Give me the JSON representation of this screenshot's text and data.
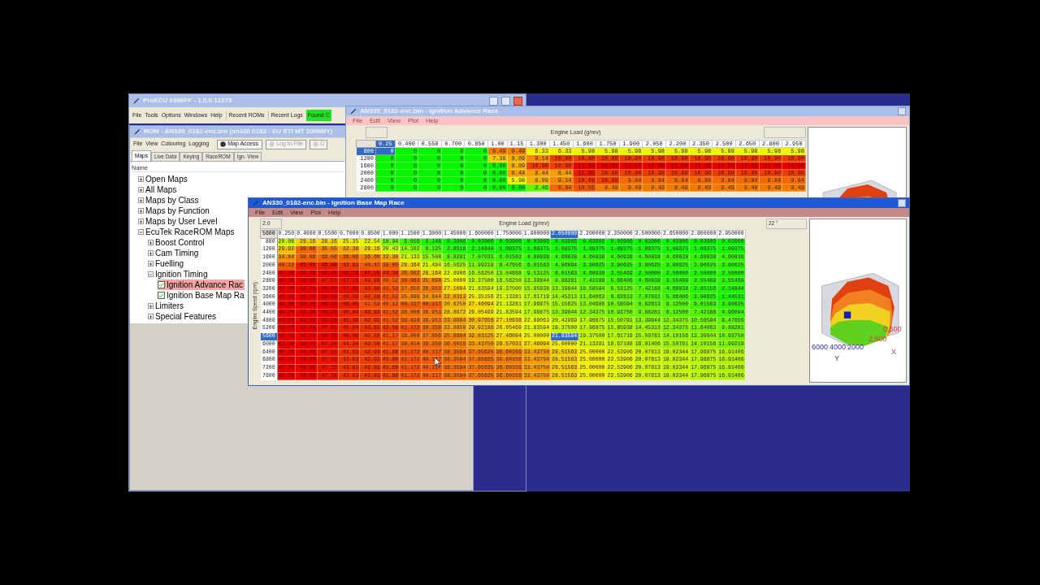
{
  "main_window": {
    "title": "ProECU 6986FF - 1.0.0.12275",
    "active": false,
    "menu": [
      "File",
      "Tools",
      "Options",
      "Windows",
      "Help"
    ],
    "toolbar": [
      {
        "label": "Recent ROMs",
        "kind": "button"
      },
      {
        "label": "Recent Logs",
        "kind": "button"
      },
      {
        "label": "Found C",
        "kind": "status"
      }
    ]
  },
  "rom_window": {
    "title": "ROM - AN330_0182-enc.bin (an330 0182 - EU STI MT 2008MY)",
    "active": false,
    "menu": [
      "File",
      "View",
      "Colouring",
      "Logging"
    ],
    "buttons": [
      {
        "label": "Map Access",
        "disabled": false
      },
      {
        "label": "Log to File",
        "disabled": true
      },
      {
        "label": "O",
        "disabled": true
      }
    ],
    "tabs": [
      {
        "label": "Maps",
        "selected": true
      },
      {
        "label": "Live Data",
        "selected": false
      },
      {
        "label": "Keying",
        "selected": false
      },
      {
        "label": "RaceROM",
        "selected": false
      },
      {
        "label": "Ign. View",
        "selected": false
      }
    ],
    "tree_header": "Name",
    "tree": [
      {
        "label": "Open Maps",
        "kind": "folder",
        "expanded": false,
        "selected": false
      },
      {
        "label": "All Maps",
        "kind": "folder",
        "expanded": false,
        "selected": false
      },
      {
        "label": "Maps by Class",
        "kind": "folder",
        "expanded": false,
        "selected": false
      },
      {
        "label": "Maps by Function",
        "kind": "folder",
        "expanded": false,
        "selected": false
      },
      {
        "label": "Maps by User Level",
        "kind": "folder",
        "expanded": false,
        "selected": false
      },
      {
        "label": "EcuTek RaceROM Maps",
        "kind": "folder",
        "expanded": true,
        "selected": false,
        "children": [
          {
            "label": "Boost Control",
            "kind": "folder",
            "expanded": false,
            "selected": false
          },
          {
            "label": "Cam Timing",
            "kind": "folder",
            "expanded": false,
            "selected": false
          },
          {
            "label": "Fuelling",
            "kind": "folder",
            "expanded": false,
            "selected": false
          },
          {
            "label": "Ignition Timing",
            "kind": "folder",
            "expanded": true,
            "selected": false,
            "children": [
              {
                "label": "Ignition Advance Rac",
                "kind": "map",
                "checked": true,
                "selected": true
              },
              {
                "label": "Ignition Base Map Ra",
                "kind": "map",
                "checked": true,
                "selected": false
              }
            ]
          },
          {
            "label": "Limiters",
            "kind": "folder",
            "expanded": false,
            "selected": false
          },
          {
            "label": "Special Features",
            "kind": "folder",
            "expanded": false,
            "selected": false
          }
        ]
      }
    ]
  },
  "advance_window": {
    "title": "AN330_0182-enc.bin - Ignition Advance Race",
    "active": false,
    "menu": [
      "File",
      "Edit",
      "View",
      "Plot",
      "Help"
    ],
    "axis_label": "Engine Load (g/rev)",
    "columns": [
      {
        "label": "0.25",
        "selected": true
      },
      {
        "label": "0.400",
        "selected": false
      },
      {
        "label": "0.550",
        "selected": false
      },
      {
        "label": "0.700",
        "selected": false
      },
      {
        "label": "0.850",
        "selected": false
      },
      {
        "label": "1.00",
        "selected": false
      },
      {
        "label": "1.15",
        "selected": false
      },
      {
        "label": "1.300",
        "selected": false
      },
      {
        "label": "1.450",
        "selected": false
      },
      {
        "label": "1.600",
        "selected": false
      },
      {
        "label": "1.750",
        "selected": false
      },
      {
        "label": "1.900",
        "selected": false
      },
      {
        "label": "2.050",
        "selected": false
      },
      {
        "label": "2.200",
        "selected": false
      },
      {
        "label": "2.350",
        "selected": false
      },
      {
        "label": "2.500",
        "selected": false
      },
      {
        "label": "2.650",
        "selected": false
      },
      {
        "label": "2.800",
        "selected": false
      },
      {
        "label": "2.950",
        "selected": false
      }
    ],
    "rows": [
      {
        "rpm": "800",
        "selected": true,
        "cells": [
          "0",
          "0",
          "0",
          "0",
          "0",
          "9.49",
          "9.49",
          "6.33",
          "6.33",
          "5.98",
          "5.98",
          "5.98",
          "5.98",
          "5.98",
          "5.98",
          "5.98",
          "5.98",
          "5.98",
          "5.98"
        ]
      },
      {
        "rpm": "1200",
        "selected": false,
        "cells": [
          "0",
          "0",
          "0",
          "0",
          "0",
          "7.38",
          "8.09",
          "9.14",
          "10.90",
          "10.90",
          "10.90",
          "10.90",
          "10.90",
          "10.90",
          "10.90",
          "10.90",
          "10.90",
          "10.90",
          "10.90"
        ]
      },
      {
        "rpm": "1600",
        "selected": false,
        "cells": [
          "0",
          "0",
          "0",
          "0",
          "0",
          "0.00",
          "8.09",
          "10.90",
          "10.90",
          "12.66",
          "12.66",
          "12.66",
          "12.66",
          "12.66",
          "12.66",
          "12.66",
          "12.66",
          "12.66",
          "12.66"
        ]
      },
      {
        "rpm": "2000",
        "selected": false,
        "cells": [
          "0",
          "0",
          "0",
          "0",
          "0",
          "0.00",
          "8.44",
          "8.44",
          "8.44",
          "11.95",
          "10.90",
          "10.90",
          "10.90",
          "10.90",
          "10.90",
          "10.90",
          "10.90",
          "10.90",
          "10.90"
        ]
      },
      {
        "rpm": "2400",
        "selected": false,
        "cells": [
          "0",
          "0",
          "0",
          "0",
          "0",
          "0.00",
          "5.98",
          "8.09",
          "9.14",
          "10.90",
          "10.90",
          "9.84",
          "9.84",
          "9.84",
          "9.84",
          "9.84",
          "9.84",
          "9.84",
          "9.84"
        ]
      },
      {
        "rpm": "2800",
        "selected": false,
        "cells": [
          "0",
          "0",
          "0",
          "0",
          "0",
          "0.00",
          "0.00",
          "2.46",
          "9.84",
          "10.55",
          "9.49",
          "9.49",
          "9.49",
          "9.49",
          "9.49",
          "9.49",
          "9.49",
          "9.49",
          "9.49"
        ]
      }
    ]
  },
  "base_window": {
    "title": "AN330_0182-enc.bin - Ignition Base Map Race",
    "active": true,
    "menu": [
      "File",
      "Edit",
      "View",
      "Plot",
      "Help"
    ],
    "field": "2.0",
    "axis_label": "Engine Load (g/rev)",
    "angle": "22 °",
    "corner": "5600",
    "y_axis_label": "Engine Speed (rpm)",
    "columns": [
      {
        "label": "0.250",
        "selected": false
      },
      {
        "label": "0.4000",
        "selected": false
      },
      {
        "label": "0.5500",
        "selected": false
      },
      {
        "label": "0.7000",
        "selected": false
      },
      {
        "label": "0.8500",
        "selected": false
      },
      {
        "label": "1.000",
        "selected": false
      },
      {
        "label": "1.1500",
        "selected": false
      },
      {
        "label": "1.3000",
        "selected": false
      },
      {
        "label": "1.45000",
        "selected": false
      },
      {
        "label": "1.600000",
        "selected": false
      },
      {
        "label": "1.750000",
        "selected": false
      },
      {
        "label": "1.900000",
        "selected": false
      },
      {
        "label": "2.050000",
        "selected": true
      },
      {
        "label": "2.200000",
        "selected": false
      },
      {
        "label": "2.350000",
        "selected": false
      },
      {
        "label": "2.500000",
        "selected": false
      },
      {
        "label": "2.650000",
        "selected": false
      },
      {
        "label": "2.800000",
        "selected": false
      },
      {
        "label": "2.950000",
        "selected": false
      }
    ],
    "rows": [
      {
        "rpm": "800",
        "selected": false,
        "cells": [
          "20.08",
          "28.16",
          "28.16",
          "25.35",
          "22.54",
          "10.94",
          "6.016",
          "2.148",
          "0.3906",
          "0.03906",
          "0.03906",
          "0.03906",
          "0.03906",
          "0.03906",
          "0.03906",
          "0.03906",
          "0.03906",
          "0.03906",
          "0.03906"
        ]
      },
      {
        "rpm": "1200",
        "selected": false,
        "cells": [
          "29.92",
          "39.06",
          "35.55",
          "32.38",
          "28.16",
          "20.43",
          "14.102",
          "8.125",
          "2.8516",
          "2.14844",
          "1.09375",
          "1.09375",
          "1.09375",
          "1.09375",
          "1.09375",
          "1.09375",
          "1.09375",
          "1.09375",
          "1.09375"
        ]
      },
      {
        "rpm": "1600",
        "selected": false,
        "cells": [
          "34.84",
          "39.06",
          "39.06",
          "39.06",
          "36.60",
          "32.38",
          "21.133",
          "15.508",
          "8.8281",
          "7.07031",
          "6.01563",
          "4.60938",
          "4.60938",
          "4.60938",
          "4.60938",
          "4.60938",
          "4.60938",
          "4.60938",
          "4.60938"
        ]
      },
      {
        "rpm": "2000",
        "selected": false,
        "cells": [
          "40.12",
          "46.09",
          "46.09",
          "42.93",
          "40.47",
          "39.06",
          "28.164",
          "21.484",
          "16.5625",
          "11.99219",
          "8.47656",
          "6.01563",
          "4.96094",
          "3.90625",
          "3.90625",
          "3.90625",
          "3.90625",
          "3.90625",
          "3.90625"
        ]
      },
      {
        "rpm": "2400",
        "selected": false,
        "cells": [
          "49.26",
          "49.26",
          "49.26",
          "49.26",
          "47.15",
          "44.34",
          "36.602",
          "28.164",
          "22.8906",
          "16.56250",
          "13.04688",
          "9.53125",
          "6.01563",
          "4.60938",
          "3.55469",
          "2.50000",
          "2.50000",
          "2.50000",
          "2.50000"
        ]
      },
      {
        "rpm": "2800",
        "selected": false,
        "cells": [
          "49.26",
          "49.26",
          "47.01",
          "47.15",
          "43.98",
          "40.12",
          "39.063",
          "35.898",
          "25.0000",
          "19.37500",
          "16.56250",
          "13.39844",
          "9.88281",
          "7.42188",
          "5.66406",
          "4.60938",
          "3.55469",
          "3.55469",
          "3.55469"
        ]
      },
      {
        "rpm": "3200",
        "selected": false,
        "cells": [
          "49.26",
          "49.26",
          "49.26",
          "47.85",
          "43.98",
          "41.52",
          "37.656",
          "36.953",
          "27.1094",
          "21.83594",
          "19.37500",
          "15.85938",
          "13.39844",
          "10.58594",
          "9.53125",
          "7.42188",
          "4.60938",
          "2.85156",
          "2.14844"
        ]
      },
      {
        "rpm": "3600",
        "selected": false,
        "cells": [
          "49.26",
          "49.26",
          "49.26",
          "45.39",
          "42.58",
          "41.52",
          "35.898",
          "34.844",
          "32.0313",
          "25.35156",
          "21.13281",
          "17.61719",
          "14.45313",
          "11.64063",
          "8.82813",
          "7.07031",
          "5.66406",
          "3.90625",
          "1.44531"
        ]
      },
      {
        "rpm": "4000",
        "selected": false,
        "cells": [
          "49.26",
          "49.26",
          "49.26",
          "46.45",
          "41.52",
          "40.12",
          "40.117",
          "40.117",
          "30.6250",
          "27.46094",
          "21.13281",
          "17.96875",
          "15.15625",
          "13.04688",
          "10.58594",
          "8.82813",
          "8.12500",
          "6.01563",
          "3.90625"
        ]
      },
      {
        "rpm": "4400",
        "selected": false,
        "cells": [
          "49.26",
          "49.26",
          "49.26",
          "45.04",
          "43.63",
          "41.52",
          "38.008",
          "36.953",
          "28.8672",
          "26.05469",
          "21.83594",
          "17.96875",
          "13.39844",
          "12.34375",
          "10.93750",
          "9.88281",
          "8.12500",
          "7.42188",
          "4.96094"
        ]
      },
      {
        "rpm": "4800",
        "selected": false,
        "cells": [
          "49.26",
          "49.26",
          "49.26",
          "45.39",
          "42.93",
          "41.52",
          "39.414",
          "36.953",
          "33.8984",
          "30.97656",
          "27.10938",
          "22.89063",
          "20.42969",
          "17.96875",
          "15.50781",
          "13.39844",
          "12.34375",
          "10.58594",
          "8.47656"
        ]
      },
      {
        "rpm": "5200",
        "selected": false,
        "cells": [
          "49.26",
          "49.26",
          "47.85",
          "45.04",
          "43.63",
          "42.58",
          "41.172",
          "38.359",
          "33.0859",
          "29.92188",
          "26.05469",
          "21.83594",
          "19.37500",
          "17.96875",
          "15.85938",
          "14.45313",
          "12.34375",
          "11.64063",
          "9.88281"
        ]
      },
      {
        "rpm": "5600",
        "selected": true,
        "cells": [
          "49.26",
          "49.26",
          "49.26",
          "46.09",
          "42.58",
          "41.17",
          "38.008",
          "37.656",
          "35.8984",
          "32.03125",
          "27.46094",
          "25.00000",
          "21.83594",
          "19.37500",
          "17.61719",
          "15.50781",
          "14.10156",
          "13.39844",
          "10.93750"
        ]
      },
      {
        "rpm": "6000",
        "selected": false,
        "cells": [
          "49.26",
          "49.26",
          "47.50",
          "44.34",
          "42.58",
          "41.17",
          "39.414",
          "38.359",
          "36.6016",
          "33.43750",
          "29.57031",
          "27.46094",
          "25.00000",
          "21.13281",
          "18.67188",
          "16.91406",
          "15.50781",
          "14.10156",
          "11.99219"
        ]
      },
      {
        "rpm": "6400",
        "selected": false,
        "cells": [
          "49.26",
          "49.26",
          "47.15",
          "43.63",
          "42.93",
          "41.88",
          "41.172",
          "40.117",
          "38.3594",
          "37.65625",
          "36.60156",
          "33.43750",
          "28.51563",
          "25.00000",
          "22.53906",
          "20.07813",
          "19.02344",
          "17.96875",
          "16.91406"
        ]
      },
      {
        "rpm": "6800",
        "selected": false,
        "cells": [
          "49.26",
          "49.26",
          "47.15",
          "43.63",
          "42.93",
          "41.88",
          "41.172",
          "40.117",
          "38.3594",
          "37.65625",
          "36.60156",
          "33.43750",
          "28.51563",
          "25.00000",
          "22.53906",
          "20.07813",
          "19.02344",
          "17.96875",
          "16.91406"
        ]
      },
      {
        "rpm": "7200",
        "selected": false,
        "cells": [
          "49.26",
          "49.26",
          "47.15",
          "43.63",
          "42.93",
          "41.88",
          "41.172",
          "40.117",
          "38.3594",
          "37.65625",
          "36.60156",
          "33.43750",
          "28.51563",
          "25.00000",
          "22.53906",
          "20.07813",
          "19.02344",
          "17.96875",
          "16.91406"
        ]
      },
      {
        "rpm": "7600",
        "selected": false,
        "cells": [
          "49.26",
          "49.26",
          "47.15",
          "43.63",
          "42.93",
          "41.88",
          "41.172",
          "40.117",
          "38.3594",
          "37.65625",
          "36.60156",
          "33.43750",
          "28.51563",
          "25.00000",
          "22.53906",
          "20.07813",
          "19.02344",
          "17.96875",
          "16.91406"
        ]
      }
    ],
    "plot": {
      "y_ticks": [
        "6000",
        "4000",
        "2000"
      ],
      "y_label": "Y",
      "x_ticks": [
        "2.500",
        "0.500"
      ],
      "x_label": "X"
    }
  }
}
